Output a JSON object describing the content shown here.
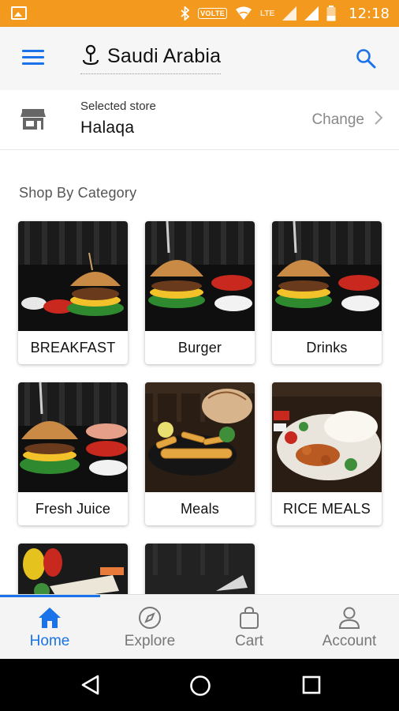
{
  "status_bar": {
    "time": "12:18",
    "volte": "VOLTE",
    "lte": "LTE",
    "background_color": "#f39a1e"
  },
  "app_bar": {
    "location_title": "Saudi Arabia",
    "icons": [
      "menu-icon",
      "location-pin-icon",
      "search-icon"
    ],
    "accent_color": "#1a73e8"
  },
  "store": {
    "label": "Selected store",
    "name": "Halaqa",
    "change_label": "Change",
    "icon": "store-icon"
  },
  "section": {
    "title": "Shop By Category"
  },
  "categories": [
    {
      "label": "BREAKFAST",
      "image": "burger-photo"
    },
    {
      "label": "Burger",
      "image": "burger-photo"
    },
    {
      "label": "Drinks",
      "image": "burger-photo"
    },
    {
      "label": "Fresh Juice",
      "image": "burger-photo"
    },
    {
      "label": "Meals",
      "image": "fried-meal-photo"
    },
    {
      "label": "RICE MEALS",
      "image": "rice-meal-photo"
    },
    {
      "label": "",
      "image": "wrap-photo"
    },
    {
      "label": "",
      "image": "dark-dish-photo"
    }
  ],
  "bottom_nav": {
    "items": [
      {
        "label": "Home",
        "icon": "home-icon",
        "active": true
      },
      {
        "label": "Explore",
        "icon": "compass-icon",
        "active": false
      },
      {
        "label": "Cart",
        "icon": "shopping-bag-icon",
        "active": false
      },
      {
        "label": "Account",
        "icon": "person-icon",
        "active": false
      }
    ]
  },
  "android_nav": {
    "icons": [
      "back-icon",
      "home-circle-icon",
      "recents-icon"
    ]
  }
}
